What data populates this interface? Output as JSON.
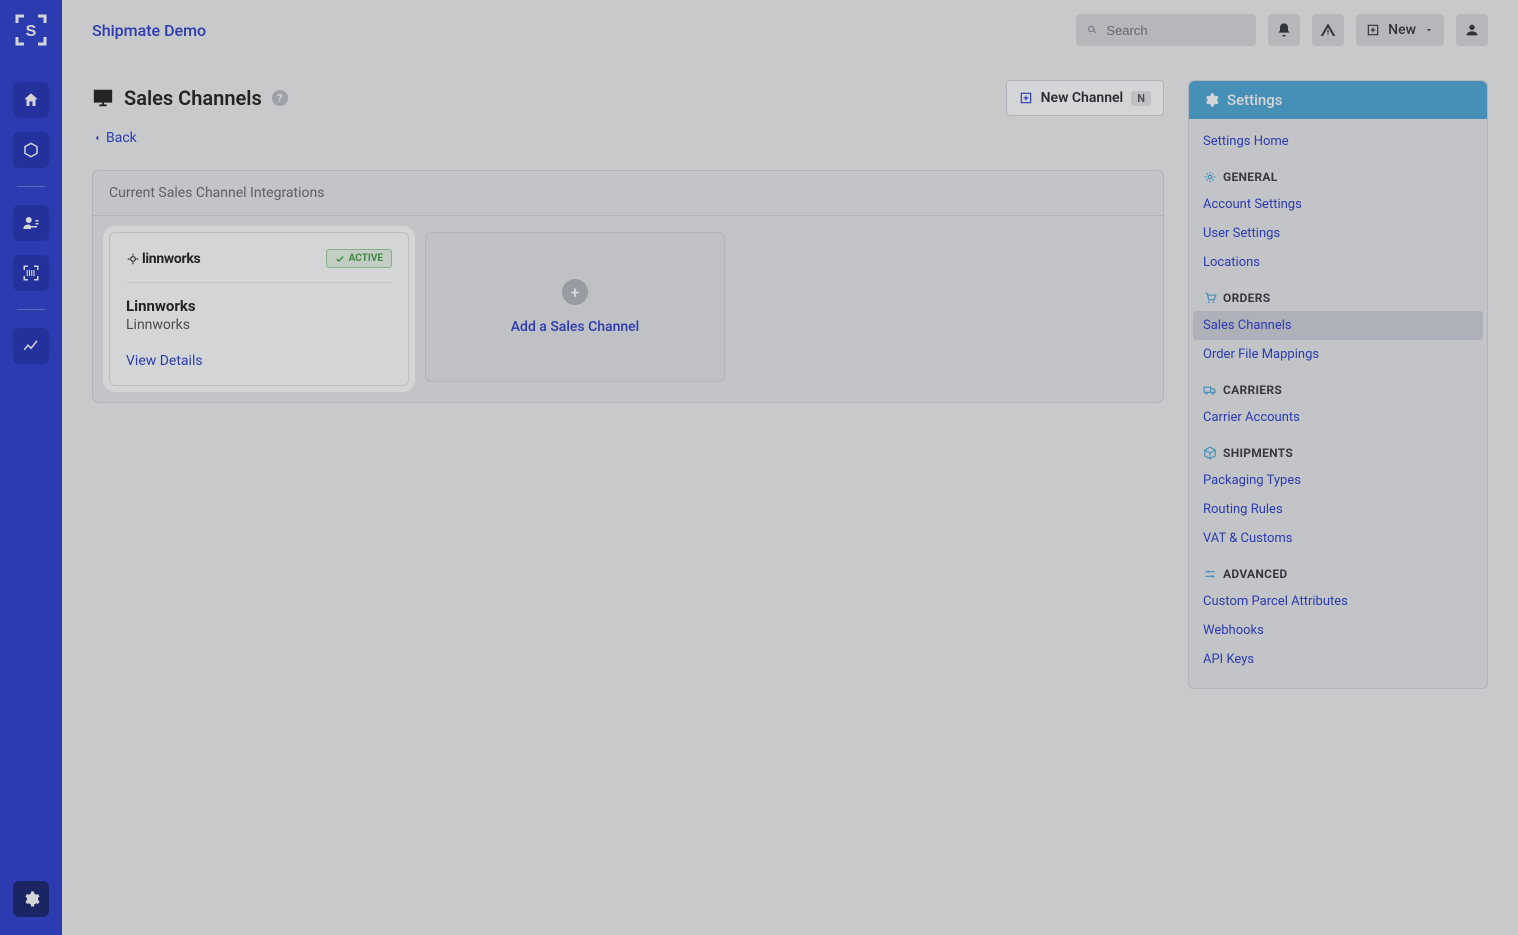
{
  "app": {
    "brand": "Shipmate Demo"
  },
  "topbar": {
    "search_placeholder": "Search",
    "new_label": "New"
  },
  "page": {
    "title": "Sales Channels",
    "back": "Back",
    "new_channel": "New Channel",
    "new_channel_key": "N",
    "panel_title": "Current Sales Channel Integrations",
    "add_channel": "Add a Sales Channel"
  },
  "channel_card": {
    "vendor_logo_text": "linnworks",
    "badge": "ACTIVE",
    "title": "Linnworks",
    "subtitle": "Linnworks",
    "view": "View Details"
  },
  "settings": {
    "header": "Settings",
    "home": "Settings Home",
    "groups": {
      "general": {
        "label": "GENERAL",
        "items": [
          "Account Settings",
          "User Settings",
          "Locations"
        ]
      },
      "orders": {
        "label": "ORDERS",
        "items": [
          "Sales Channels",
          "Order File Mappings"
        ]
      },
      "carriers": {
        "label": "CARRIERS",
        "items": [
          "Carrier Accounts"
        ]
      },
      "shipments": {
        "label": "SHIPMENTS",
        "items": [
          "Packaging Types",
          "Routing Rules",
          "VAT & Customs"
        ]
      },
      "advanced": {
        "label": "ADVANCED",
        "items": [
          "Custom Parcel Attributes",
          "Webhooks",
          "API Keys"
        ]
      }
    }
  }
}
